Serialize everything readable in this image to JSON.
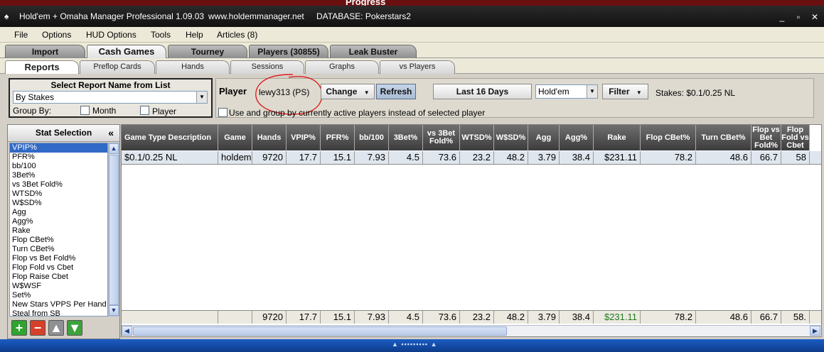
{
  "top_strip_text": "Progress",
  "window": {
    "title_app": "Hold'em + Omaha Manager Professional 1.09.03",
    "title_url": "www.holdemmanager.net",
    "title_db": "DATABASE: Pokerstars2",
    "icon": "spade-icon",
    "minimize": "_",
    "restore": "▫",
    "close": "✕"
  },
  "menu": [
    "File",
    "Options",
    "HUD Options",
    "Tools",
    "Help",
    "Articles (8)"
  ],
  "main_tabs": [
    "Import",
    "Cash Games",
    "Tourney",
    "Players (30855)",
    "Leak Buster"
  ],
  "sub_tabs": [
    "Reports",
    "Preflop Cards",
    "Hands",
    "Sessions",
    "Graphs",
    "vs Players"
  ],
  "report": {
    "caption": "Select Report Name from List",
    "selected": "By Stakes",
    "group_by": "Group By:",
    "month": "Month",
    "player": "Player"
  },
  "player_bar": {
    "label": "Player",
    "name": "lewy313 (PS)",
    "change": "Change",
    "refresh": "Refresh",
    "range": "Last 16 Days",
    "game": "Hold'em",
    "filter": "Filter",
    "stakes": "Stakes: $0.1/0.25 NL",
    "use_group": "Use and group by currently active players instead of selected player"
  },
  "stat_selection": {
    "caption": "Stat Selection",
    "collapse": "«",
    "items": [
      "VPIP%",
      "PFR%",
      "bb/100",
      "3Bet%",
      "vs 3Bet Fold%",
      "WTSD%",
      "W$SD%",
      "Agg",
      "Agg%",
      "Rake",
      "Flop CBet%",
      "Turn CBet%",
      "Flop vs Bet Fold%",
      "Flop Fold vs Cbet",
      "Flop Raise Cbet",
      "W$WSF",
      "Set%",
      "New Stars VPPS Per Hand",
      "Steal from SB"
    ],
    "selected_index": 0,
    "buttons": [
      "add-icon",
      "remove-icon",
      "move-up-icon",
      "move-down-icon"
    ]
  },
  "table": {
    "columns": [
      "Game Type Description",
      "Game",
      "Hands",
      "VPIP%",
      "PFR%",
      "bb/100",
      "3Bet%",
      "vs 3Bet Fold%",
      "WTSD%",
      "W$SD%",
      "Agg",
      "Agg%",
      "Rake",
      "Flop CBet%",
      "Turn CBet%",
      "Flop vs Bet Fold%",
      "Flop Fold vs Cbet"
    ],
    "rows": [
      [
        "$0.1/0.25 NL",
        "holdem",
        "9720",
        "17.7",
        "15.1",
        "7.93",
        "4.5",
        "73.6",
        "23.2",
        "48.2",
        "3.79",
        "38.4",
        "$231.11",
        "78.2",
        "48.6",
        "66.7",
        "58"
      ]
    ],
    "totals": [
      "",
      "",
      "9720",
      "17.7",
      "15.1",
      "7.93",
      "4.5",
      "73.6",
      "23.2",
      "48.2",
      "3.79",
      "38.4",
      "$231.11",
      "78.2",
      "48.6",
      "66.7",
      "58."
    ],
    "accent_green": "#1f7a1f"
  },
  "colors": {
    "title_bar": "#111111",
    "header_bg": "#4a4a4a",
    "selection": "#3169c6",
    "status_bar": "#1b5cc4"
  }
}
